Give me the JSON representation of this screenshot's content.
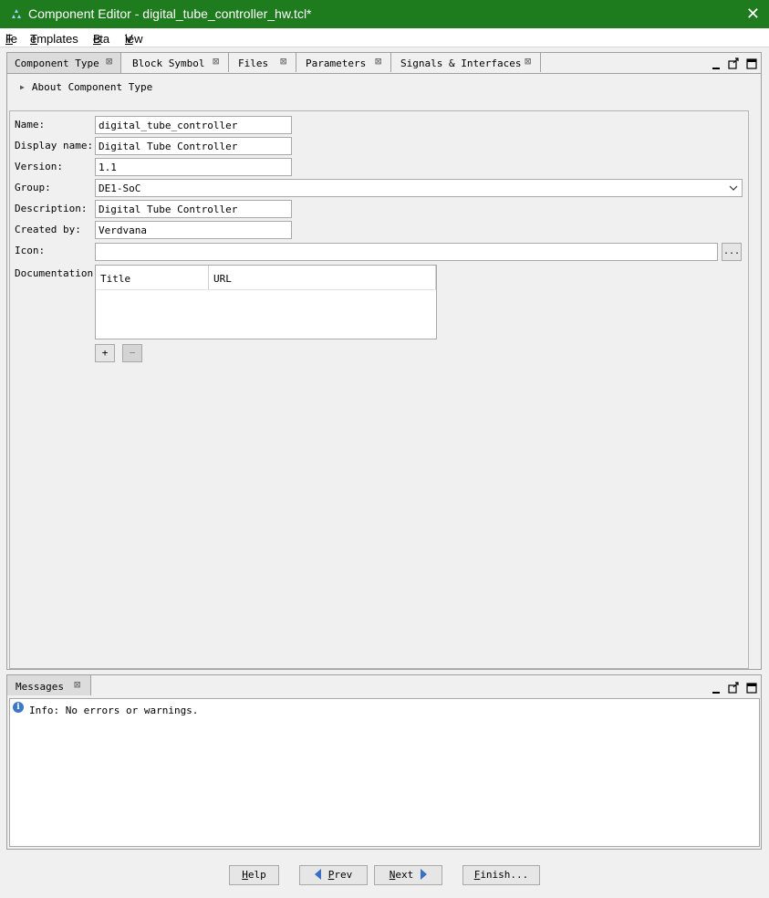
{
  "window": {
    "title": "Component Editor - digital_tube_controller_hw.tcl*",
    "close_glyph": "✕",
    "accent_color": "#1e7b1e"
  },
  "menu": {
    "file": {
      "mnemonic": "F",
      "rest": "ile"
    },
    "templates": {
      "mnemonic": "T",
      "rest": "emplates"
    },
    "beta": {
      "mnemonic": "B",
      "rest": "eta"
    },
    "view": {
      "mnemonic": "V",
      "rest": "iew"
    }
  },
  "tabs": [
    {
      "label": "Component Type",
      "active": true
    },
    {
      "label": "Block Symbol",
      "active": false
    },
    {
      "label": "Files",
      "active": false
    },
    {
      "label": "Parameters",
      "active": false
    },
    {
      "label": "Signals & Interfaces",
      "active": false
    }
  ],
  "tab_close_glyph": "⊠",
  "about_section": "About Component Type",
  "form": {
    "name": {
      "label": "Name:",
      "value": "digital_tube_controller"
    },
    "display_name": {
      "label": "Display name:",
      "value": "Digital Tube Controller"
    },
    "version": {
      "label": "Version:",
      "value": "1.1"
    },
    "group": {
      "label": "Group:",
      "value": "DE1-SoC"
    },
    "description": {
      "label": "Description:",
      "value": "Digital Tube Controller"
    },
    "created_by": {
      "label": "Created by:",
      "value": "Verdvana"
    },
    "icon": {
      "label": "Icon:",
      "value": "",
      "browse_label": "..."
    },
    "documentation": {
      "label": "Documentation:",
      "columns": [
        "Title",
        "URL"
      ],
      "add_label": "+",
      "remove_label": "−"
    }
  },
  "messages": {
    "tab_label": "Messages",
    "items": [
      "Info: No errors or warnings."
    ]
  },
  "buttons": {
    "help": {
      "mnemonic": "H",
      "rest": "elp"
    },
    "prev": {
      "mnemonic": "P",
      "rest": "rev"
    },
    "next": {
      "mnemonic": "N",
      "rest": "ext"
    },
    "finish": {
      "mnemonic": "F",
      "rest": "inish..."
    }
  },
  "icons": {
    "minimize": "minimize-icon",
    "restore": "restore-window-icon",
    "maximize": "maximize-icon",
    "info": "info-icon"
  }
}
